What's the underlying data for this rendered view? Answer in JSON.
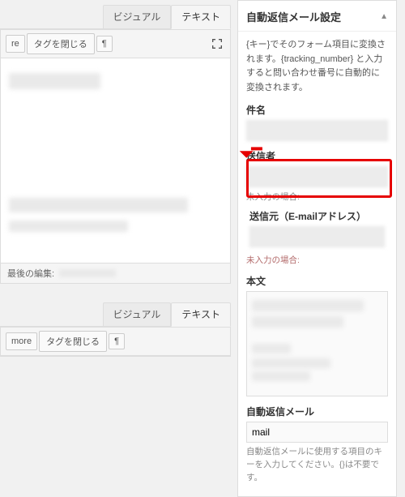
{
  "editor": {
    "tabs": {
      "visual": "ビジュアル",
      "text": "テキスト"
    },
    "toolbar": {
      "re": "re",
      "close_tags": "タグを閉じる",
      "pilcrow": "¶"
    },
    "footer": {
      "last_edit_label": "最後の編集:"
    }
  },
  "sidebar": {
    "title": "自動返信メール設定",
    "hint": "{キー}でそのフォーム項目に変換されます。{tracking_number} と入力すると問い合わせ番号に自動的に変換されます。",
    "subject_label": "件名",
    "sender_label": "送信者",
    "no_input_label": "未入力の場合:",
    "from_label": "送信元（E-mailアドレス）",
    "body_label": "本文",
    "autoreply_label": "自動返信メール",
    "autoreply_value": "mail",
    "autoreply_hint": "自動返信メールに使用する項目のキーを入力してください。{}は不要です。"
  }
}
